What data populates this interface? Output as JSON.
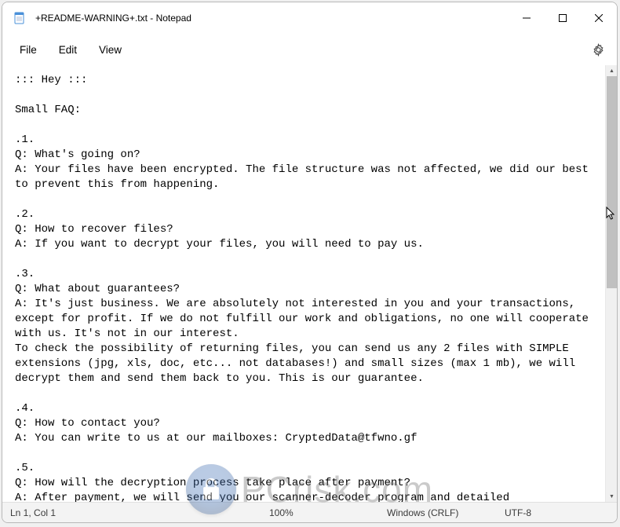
{
  "window": {
    "title": "+README-WARNING+.txt - Notepad"
  },
  "menus": {
    "file": "File",
    "edit": "Edit",
    "view": "View"
  },
  "document_text": "::: Hey :::\n\nSmall FAQ:\n\n.1.\nQ: What's going on?\nA: Your files have been encrypted. The file structure was not affected, we did our best to prevent this from happening.\n\n.2.\nQ: How to recover files?\nA: If you want to decrypt your files, you will need to pay us.\n\n.3.\nQ: What about guarantees?\nA: It's just business. We are absolutely not interested in you and your transactions, except for profit. If we do not fulfill our work and obligations, no one will cooperate with us. It's not in our interest.\nTo check the possibility of returning files, you can send us any 2 files with SIMPLE extensions (jpg, xls, doc, etc... not databases!) and small sizes (max 1 mb), we will decrypt them and send them back to you. This is our guarantee.\n\n.4.\nQ: How to contact you?\nA: You can write to us at our mailboxes: CryptedData@tfwno.gf\n\n.5.\nQ: How will the decryption process take place after payment?\nA: After payment, we will send you our scanner-decoder program and detailed instructions for use. With this program you will be able to decrypt all your encrypted files.",
  "statusbar": {
    "position": "Ln 1, Col 1",
    "zoom": "100%",
    "line_ending": "Windows (CRLF)",
    "encoding": "UTF-8"
  },
  "watermark": {
    "text_main": "PCrisk",
    "text_suffix": ".com"
  }
}
